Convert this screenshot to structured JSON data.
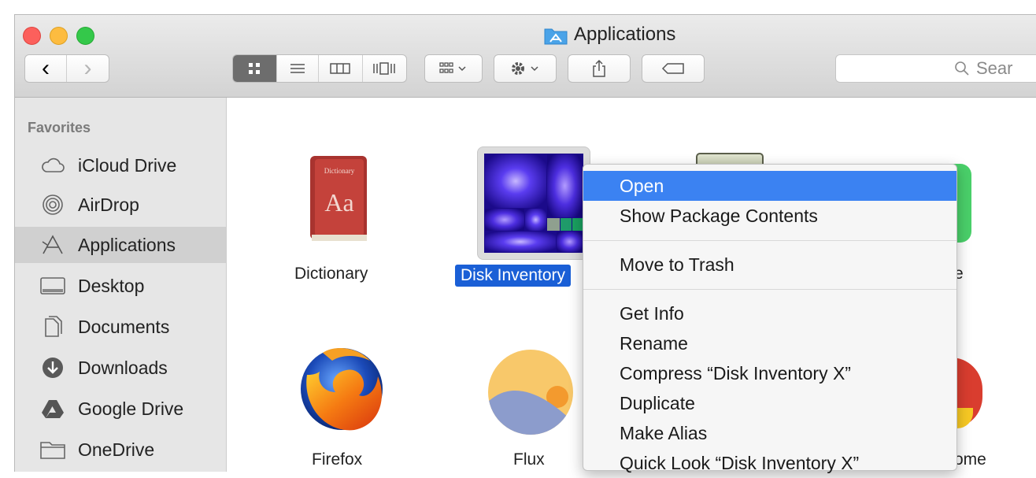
{
  "window": {
    "title": "Applications"
  },
  "toolbar": {
    "back": "‹",
    "forward": "›",
    "search_placeholder": "Sear"
  },
  "sidebar": {
    "heading": "Favorites",
    "items": [
      {
        "label": "iCloud Drive",
        "icon": "cloud-icon"
      },
      {
        "label": "AirDrop",
        "icon": "airdrop-icon"
      },
      {
        "label": "Applications",
        "icon": "applications-icon",
        "selected": true
      },
      {
        "label": "Desktop",
        "icon": "desktop-icon"
      },
      {
        "label": "Documents",
        "icon": "documents-icon"
      },
      {
        "label": "Downloads",
        "icon": "downloads-icon"
      },
      {
        "label": "Google Drive",
        "icon": "google-drive-icon"
      },
      {
        "label": "OneDrive",
        "icon": "folder-icon"
      }
    ]
  },
  "apps": [
    {
      "label": "Dictionary"
    },
    {
      "label": "Disk Inventory",
      "selected": true
    },
    {
      "label": "e"
    },
    {
      "label": "Firefox"
    },
    {
      "label": "Flux"
    },
    {
      "label": "ome"
    }
  ],
  "context_menu": {
    "items": [
      "Open",
      "Show Package Contents",
      "Move to Trash",
      "Get Info",
      "Rename",
      "Compress “Disk Inventory X”",
      "Duplicate",
      "Make Alias",
      "Quick Look “Disk Inventory X”"
    ],
    "highlighted": "Open",
    "highlight_color": "#3b82f2"
  },
  "colors": {
    "selection": "#1a5fd6",
    "sidebar_bg": "#e6e6e6"
  }
}
